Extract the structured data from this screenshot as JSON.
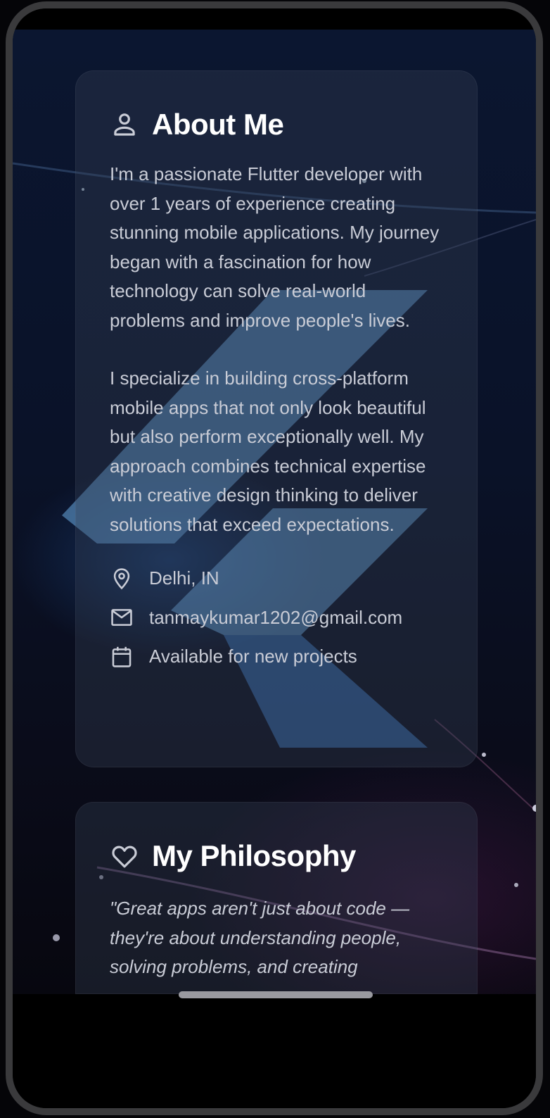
{
  "about": {
    "icon": "person-icon",
    "title": "About Me",
    "paragraph1": "I'm a passionate Flutter developer with over 1 years of experience creating stunning mobile applications. My journey began with a fascination for how technology can solve real-world problems and improve people's lives.",
    "paragraph2": "I specialize in building cross-platform mobile apps that not only look beautiful but also perform exceptionally well. My approach combines technical expertise with creative design thinking to deliver solutions that exceed expectations.",
    "info": [
      {
        "icon": "location-pin-icon",
        "text": "Delhi, IN"
      },
      {
        "icon": "mail-icon",
        "text": "tanmaykumar1202@gmail.com"
      },
      {
        "icon": "calendar-icon",
        "text": "Available for new projects"
      }
    ]
  },
  "philosophy": {
    "icon": "heart-icon",
    "title": "My Philosophy",
    "quote": "\"Great apps aren't just about code — they're about understanding people, solving problems, and creating"
  },
  "colors": {
    "card_bg": "#2a3245",
    "text": "#c9ccd6",
    "title": "#ffffff",
    "flutter_logo": "#5fa0d8"
  }
}
